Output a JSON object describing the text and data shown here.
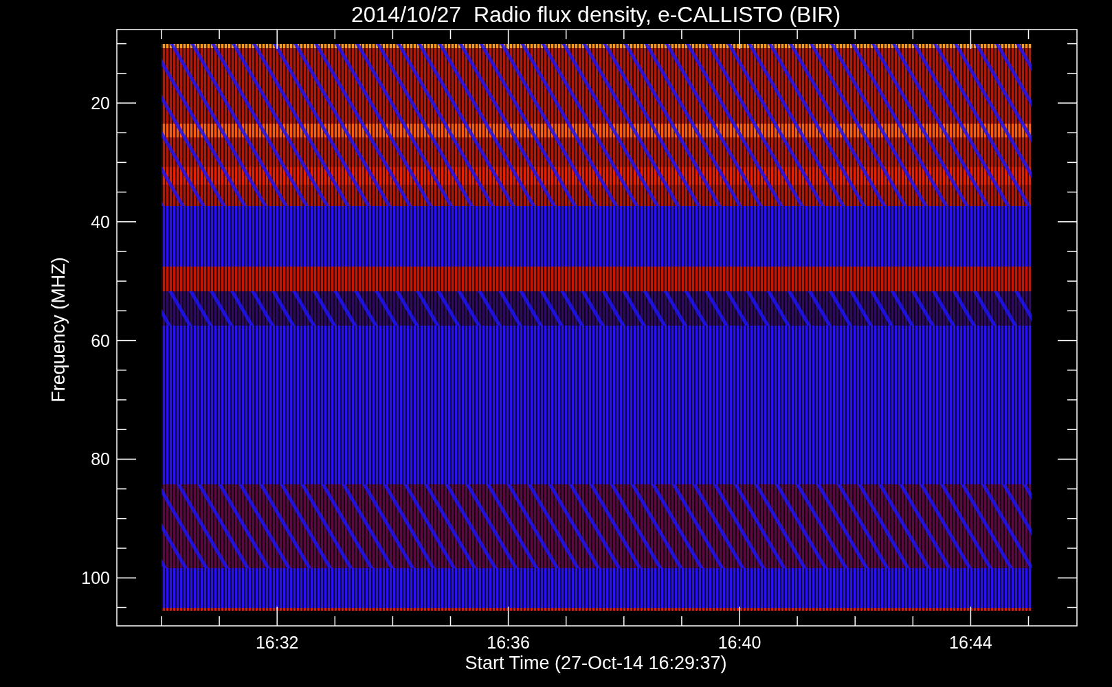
{
  "title": "2014/10/27  Radio flux density, e-CALLISTO (BIR)",
  "y_axis": {
    "label": "Frequency (MHZ)",
    "ticks": [
      "20",
      "40",
      "60",
      "80",
      "100"
    ]
  },
  "x_axis": {
    "label": "Start Time (27-Oct-14 16:29:37)",
    "ticks": [
      "16:32",
      "16:36",
      "16:40",
      "16:44"
    ]
  }
}
